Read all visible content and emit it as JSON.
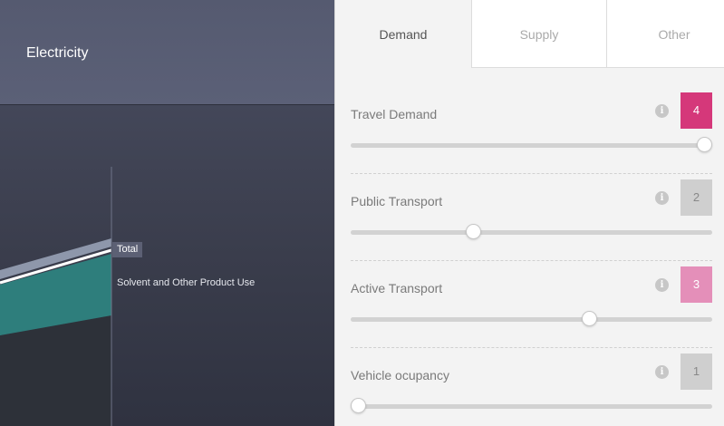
{
  "left": {
    "title": "Electricity",
    "chart_labels": {
      "total": "Total",
      "solvent": "Solvent and Other Product Use"
    }
  },
  "tabs": [
    {
      "label": "Demand",
      "active": true
    },
    {
      "label": "Supply",
      "active": false
    },
    {
      "label": "Other",
      "active": false
    }
  ],
  "info_symbol": "i",
  "controls": [
    {
      "label": "Travel Demand",
      "value": "4",
      "fraction": 1.0,
      "badge_color": "#d5387a",
      "text_color": "#ffffff"
    },
    {
      "label": "Public Transport",
      "value": "2",
      "fraction": 0.333,
      "badge_color": "#cfcfcf",
      "text_color": "#888888"
    },
    {
      "label": "Active Transport",
      "value": "3",
      "fraction": 0.667,
      "badge_color": "#e48fb9",
      "text_color": "#ffffff"
    },
    {
      "label": "Vehicle ocupancy",
      "value": "1",
      "fraction": 0.0,
      "badge_color": "#cfcfcf",
      "text_color": "#888888"
    }
  ],
  "colors": {
    "accent_pink": "#d5387a",
    "light_pink": "#e48fb9",
    "teal_area": "#2e7e7c"
  }
}
